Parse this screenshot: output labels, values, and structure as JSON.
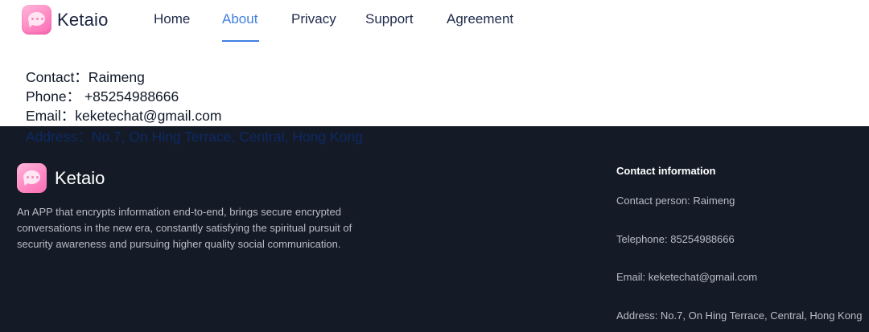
{
  "header": {
    "brand": "Ketaio",
    "nav": [
      {
        "label": "Home",
        "active": false
      },
      {
        "label": "About",
        "active": true
      },
      {
        "label": "Privacy",
        "active": false
      },
      {
        "label": "Support",
        "active": false
      },
      {
        "label": "Agreement",
        "active": false
      }
    ]
  },
  "content": {
    "contact": "Contact：Raimeng",
    "phone": "Phone： +85254988666",
    "email": "Email：keketechat@gmail.com",
    "address": "Address：No.7, On Hing Terrace, Central, Hong Kong"
  },
  "footer": {
    "brand": "Ketaio",
    "description": "An APP that encrypts information end-to-end, brings secure encrypted conversations in the new era, constantly satisfying the spiritual pursuit of security awareness and pursuing higher quality social communication.",
    "contact_title": "Contact information",
    "contact_person": "Contact person: Raimeng",
    "telephone": "Telephone: 85254988666",
    "email": "Email: keketechat@gmail.com",
    "address": "Address: No.7, On Hing Terrace, Central, Hong Kong"
  },
  "colors": {
    "accent": "#3f7fe0",
    "footer_bg": "#151b26",
    "logo_pink": "#ff86c2"
  },
  "icons": {
    "logo": "chat-bubble-icon"
  }
}
